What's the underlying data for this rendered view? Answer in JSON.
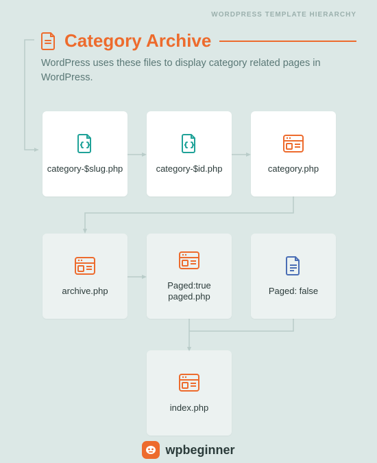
{
  "header": {
    "label": "WORDPRESS TEMPLATE HIERARCHY"
  },
  "title": {
    "text": "Category Archive"
  },
  "description": "WordPress uses these files to display category related pages in WordPress.",
  "nodes": {
    "categorySlug": {
      "label": "category-$slug.php",
      "iconType": "code-file",
      "faded": false
    },
    "categoryId": {
      "label": "category-$id.php",
      "iconType": "code-file",
      "faded": false
    },
    "categoryPhp": {
      "label": "category.php",
      "iconType": "template",
      "faded": false
    },
    "archivePhp": {
      "label": "archive.php",
      "iconType": "template",
      "faded": true
    },
    "pagedTrue": {
      "label": "Paged:true paged.php",
      "iconType": "template",
      "faded": true
    },
    "pagedFalse": {
      "label": "Paged: false",
      "iconType": "plain-file",
      "faded": true
    },
    "indexPhp": {
      "label": "index.php",
      "iconType": "template",
      "faded": true
    }
  },
  "colors": {
    "accent": "#ed6b2d",
    "teal": "#1fa298",
    "connector": "#b9ccc9"
  },
  "footer": {
    "brand": "wpbeginner"
  }
}
